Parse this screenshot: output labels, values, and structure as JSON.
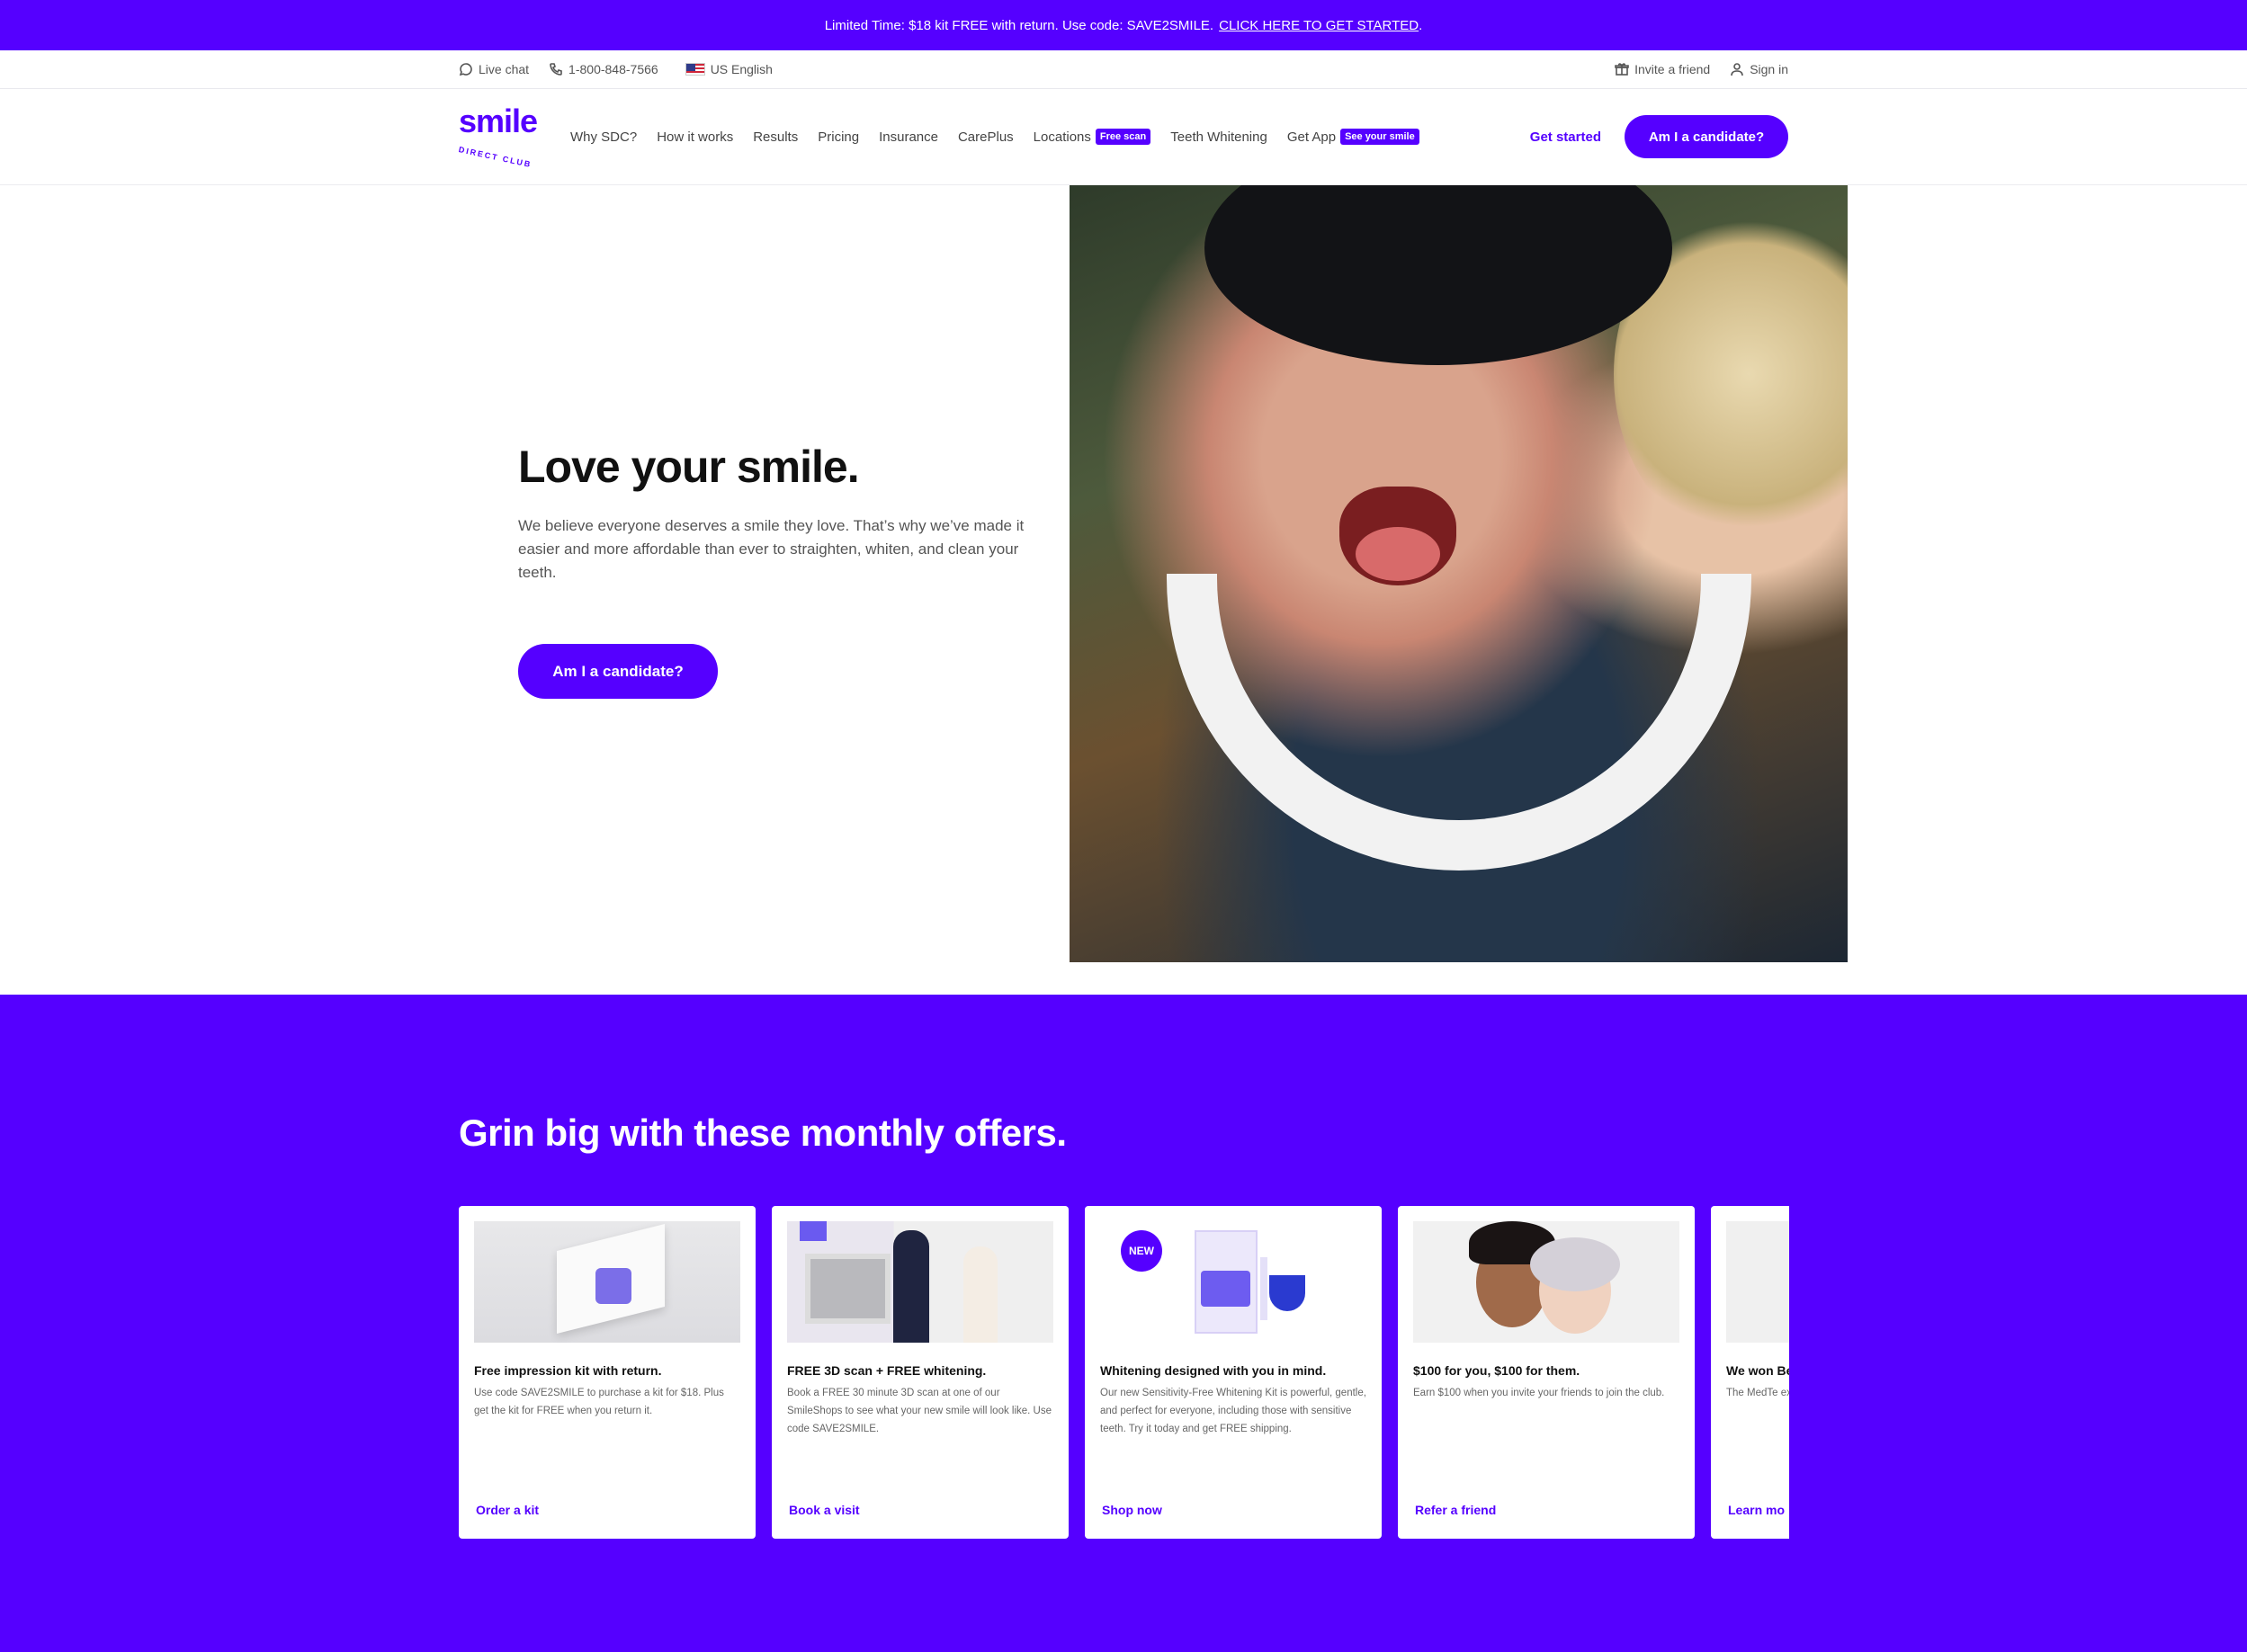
{
  "promo": {
    "text": "Limited Time: $18 kit FREE with return. Use code: SAVE2SMILE.",
    "cta": "CLICK HERE TO GET STARTED",
    "trail": "."
  },
  "utility": {
    "live_chat": "Live chat",
    "phone": "1-800-848-7566",
    "language": "US English",
    "invite": "Invite a friend",
    "sign_in": "Sign in"
  },
  "nav": {
    "logo_word": "smile",
    "logo_sub": "DIRECT CLUB",
    "items": [
      "Why SDC?",
      "How it works",
      "Results",
      "Pricing",
      "Insurance",
      "CarePlus",
      "Locations",
      "Teeth Whitening",
      "Get App"
    ],
    "locations_tag": "Free scan",
    "app_tag": "See your smile",
    "get_started": "Get started",
    "candidate": "Am I a candidate?"
  },
  "hero": {
    "title": "Love your smile.",
    "body": "We believe everyone deserves a smile they love. That’s why we’ve made it easier and more affordable than ever to straighten, whiten, and clean your teeth.",
    "cta": "Am I a candidate?"
  },
  "offers": {
    "heading": "Grin big with these monthly offers.",
    "badge_new": "NEW",
    "cards": [
      {
        "title": "Free impression kit with return.",
        "desc": "Use code SAVE2SMILE to purchase a kit for $18. Plus get the kit for FREE when you return it.",
        "action": "Order a kit"
      },
      {
        "title": "FREE 3D scan + FREE whitening.",
        "desc": "Book a FREE 30 minute 3D scan at one of our SmileShops to see what your new smile will look like. Use code SAVE2SMILE.",
        "action": "Book a visit"
      },
      {
        "title": "Whitening designed with you in mind.",
        "desc": "Our new Sensitivity-Free Whitening Kit is powerful, gentle, and perfect for everyone, including those with sensitive teeth. Try it today and get FREE shipping.",
        "action": "Shop now"
      },
      {
        "title": "$100 for you, $100 for them.",
        "desc": "Earn $100 when you invite your friends to join the club.",
        "action": "Refer a friend"
      },
      {
        "title": "We won Be",
        "desc": "The MedTe excellence d technology.",
        "action": "Learn mo"
      }
    ]
  },
  "colors": {
    "brand": "#5500ff"
  }
}
